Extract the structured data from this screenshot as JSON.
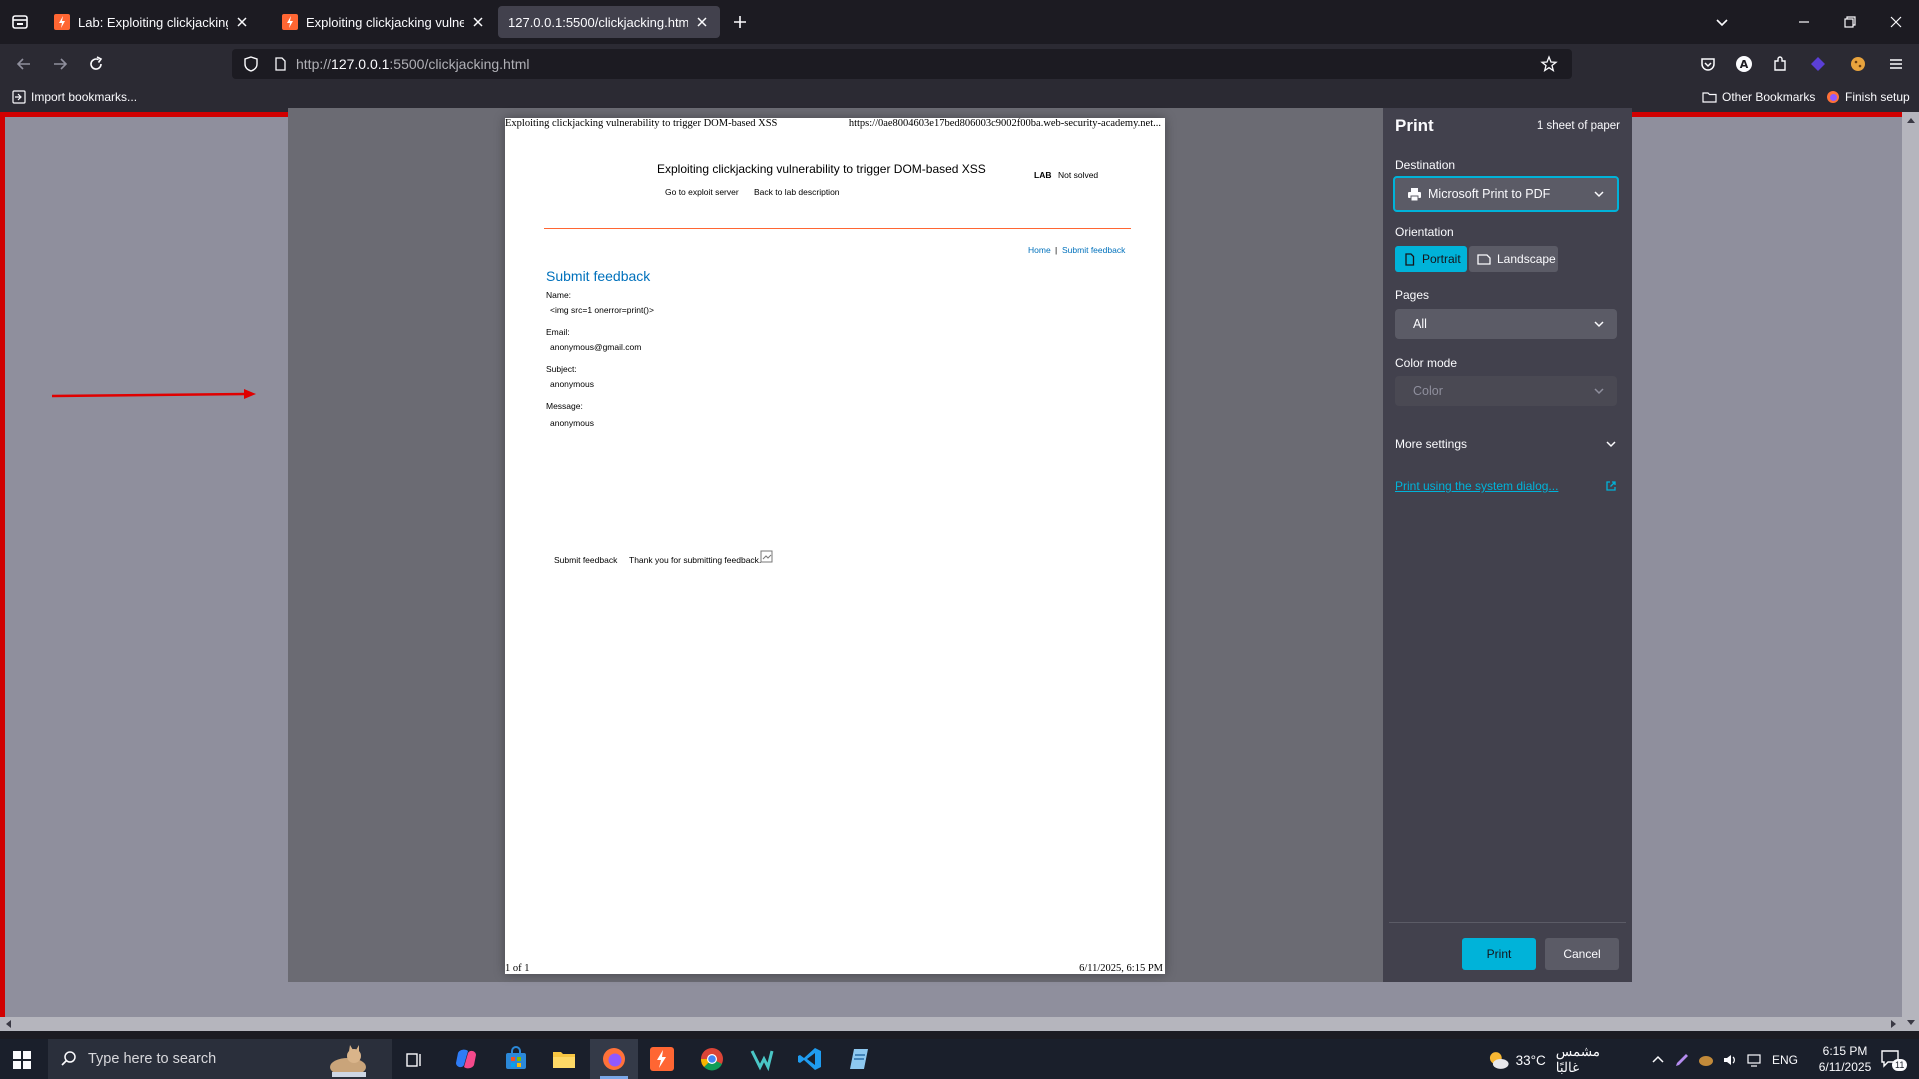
{
  "tabs": [
    {
      "label": "Lab: Exploiting clickjacking vuln",
      "active": false
    },
    {
      "label": "Exploiting clickjacking vulnerab",
      "active": false
    },
    {
      "label": "127.0.0.1:5500/clickjacking.html",
      "active": true
    }
  ],
  "urlbar": {
    "prefix": "http://",
    "host": "127.0.0.1",
    "suffix": ":5500/clickjacking.html"
  },
  "bookmarks": {
    "import": "Import bookmarks...",
    "other": "Other Bookmarks",
    "finish": "Finish setup"
  },
  "preview": {
    "header_left": "Exploiting clickjacking vulnerability to trigger DOM-based XSS",
    "header_right": "https://0ae8004603e17bed806003c9002f00ba.web-security-academy.net...",
    "lab_title": "Exploiting clickjacking vulnerability to trigger DOM-based XSS",
    "go_exploit": "Go to exploit server",
    "back_desc": "Back to lab description",
    "lab_label": "LAB",
    "lab_status": "Not solved",
    "nav_home": "Home",
    "nav_sep": "|",
    "nav_submit": "Submit feedback",
    "heading": "Submit feedback",
    "name_label": "Name:",
    "name_value": "<img src=1 onerror=print()>",
    "email_label": "Email:",
    "email_value": "anonymous@gmail.com",
    "subject_label": "Subject:",
    "subject_value": "anonymous",
    "message_label": "Message:",
    "message_value": "anonymous",
    "submit_button": "Submit feedback",
    "thanks": "Thank you for submitting feedback.",
    "footer_left": "1 of 1",
    "footer_right": "6/11/2025, 6:15 PM"
  },
  "print_panel": {
    "title": "Print",
    "sheets": "1 sheet of paper",
    "destination_label": "Destination",
    "destination_value": "Microsoft Print to PDF",
    "orientation_label": "Orientation",
    "portrait": "Portrait",
    "landscape": "Landscape",
    "pages_label": "Pages",
    "pages_value": "All",
    "color_label": "Color mode",
    "color_value": "Color",
    "more_settings": "More settings",
    "system_dialog": "Print using the system dialog...",
    "print_button": "Print",
    "cancel_button": "Cancel"
  },
  "taskbar": {
    "search_placeholder": "Type here to search",
    "weather_temp": "33°C",
    "weather_desc": "مشمس غالبًا",
    "lang": "ENG",
    "time": "6:15 PM",
    "date": "6/11/2025",
    "notif_count": "11"
  },
  "colors": {
    "accent": "#00b3d9",
    "annotation_arrow": "#e00000",
    "link_blue": "#0071bc",
    "lab_rule": "#ff6633"
  }
}
